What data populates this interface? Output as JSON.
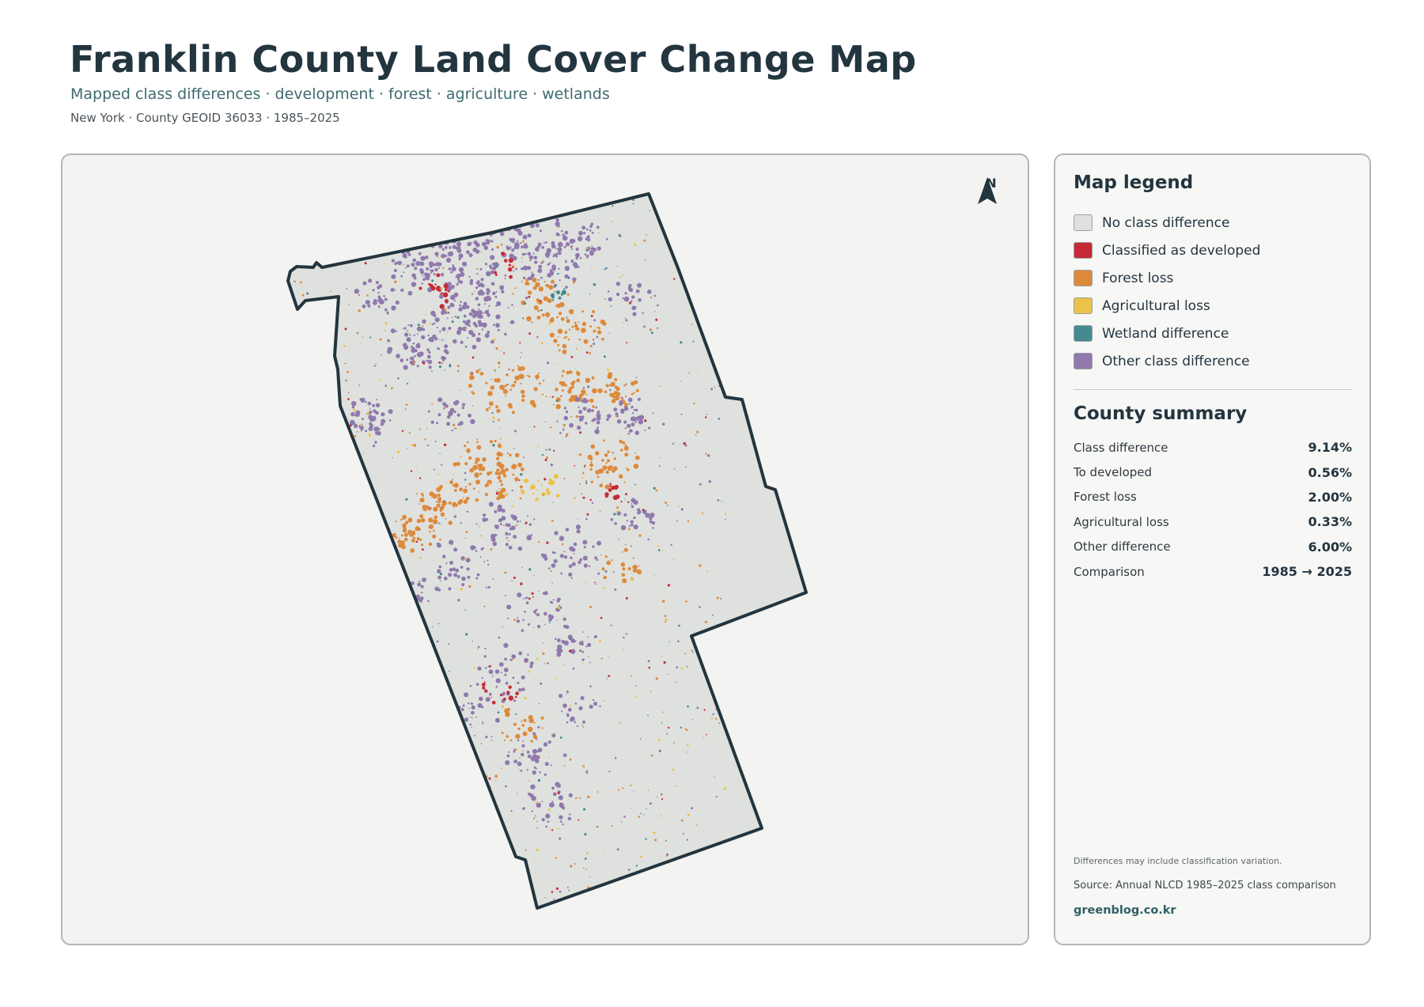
{
  "header": {
    "title": "Franklin County Land Cover Change Map",
    "subtitle": "Mapped class differences · development · forest · agriculture · wetlands",
    "meta": "New York · County GEOID 36033 · 1985–2025"
  },
  "map": {
    "north_label": "N",
    "colors": {
      "no_change": "#dfe1de",
      "developed": "#c62a37",
      "forest_loss": "#dd8a3a",
      "agricultural_loss": "#ecc248",
      "wetland": "#448b91",
      "other": "#9079ad",
      "boundary": "#23353f",
      "background": "#f3f3f1"
    }
  },
  "legend": {
    "title": "Map legend",
    "items": [
      {
        "label": "No class difference",
        "color": "#dfe1de"
      },
      {
        "label": "Classified as developed",
        "color": "#c62a37"
      },
      {
        "label": "Forest loss",
        "color": "#dd8a3a"
      },
      {
        "label": "Agricultural loss",
        "color": "#ecc248"
      },
      {
        "label": "Wetland difference",
        "color": "#448b91"
      },
      {
        "label": "Other class difference",
        "color": "#9079ad"
      }
    ]
  },
  "summary": {
    "title": "County summary",
    "rows": [
      {
        "label": "Class difference",
        "value": "9.14%"
      },
      {
        "label": "To developed",
        "value": "0.56%"
      },
      {
        "label": "Forest loss",
        "value": "2.00%"
      },
      {
        "label": "Agricultural loss",
        "value": "0.33%"
      },
      {
        "label": "Other difference",
        "value": "6.00%"
      },
      {
        "label": "Comparison",
        "value": "1985 → 2025"
      }
    ]
  },
  "footer": {
    "note": "Differences may include classification variation.",
    "source": "Source: Annual NLCD 1985–2025 class comparison",
    "site": "greenblog.co.kr"
  }
}
